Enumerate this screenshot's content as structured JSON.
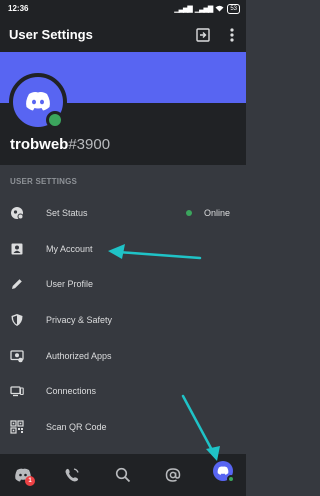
{
  "status_bar": {
    "time": "12:36",
    "battery": "53"
  },
  "header": {
    "title": "User Settings"
  },
  "profile": {
    "name": "trobweb",
    "discriminator": "#3900"
  },
  "section": {
    "title": "USER SETTINGS"
  },
  "menu": {
    "items": [
      {
        "label": "Set Status",
        "icon": "status-icon",
        "value": "Online"
      },
      {
        "label": "My Account",
        "icon": "account-icon"
      },
      {
        "label": "User Profile",
        "icon": "pencil-icon"
      },
      {
        "label": "Privacy & Safety",
        "icon": "shield-icon"
      },
      {
        "label": "Authorized Apps",
        "icon": "apps-icon"
      },
      {
        "label": "Connections",
        "icon": "connections-icon"
      },
      {
        "label": "Scan QR Code",
        "icon": "qr-code-icon"
      }
    ]
  },
  "bottom_nav": {
    "items": [
      "home-icon",
      "friends-icon",
      "search-icon",
      "mentions-icon",
      "profile-icon"
    ],
    "home_badge": "1"
  },
  "colors": {
    "accent": "#5865f2",
    "online": "#3ba55d",
    "arrow": "#1fc3c7",
    "badge": "#ed4245"
  }
}
